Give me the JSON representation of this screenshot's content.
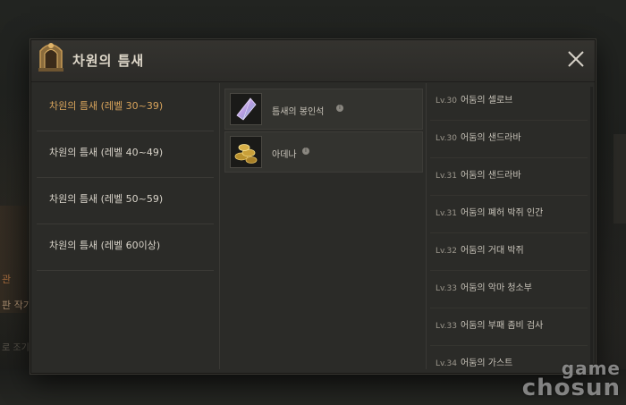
{
  "dialog": {
    "title": "차원의 틈새"
  },
  "levels": [
    {
      "label": "차원의 틈새 (레벨 30~39)"
    },
    {
      "label": "차원의 틈새 (레벨 40~49)"
    },
    {
      "label": "차원의 틈새 (레벨 50~59)"
    },
    {
      "label": "차원의 틈새 (레벨 60이상)"
    }
  ],
  "rewards": [
    {
      "label": "틈새의 봉인석",
      "icon": "crystal-icon"
    },
    {
      "label": "아데나",
      "icon": "gold-coins-icon"
    }
  ],
  "monsters": [
    {
      "level": "Lv.30",
      "name": "어둠의 셀로브"
    },
    {
      "level": "Lv.30",
      "name": "어둠의 샌드라바"
    },
    {
      "level": "Lv.31",
      "name": "어둠의 샌드라바"
    },
    {
      "level": "Lv.31",
      "name": "어둠의 폐허 박쥐 인간"
    },
    {
      "level": "Lv.32",
      "name": "어둠의 거대 박쥐"
    },
    {
      "level": "Lv.33",
      "name": "어둠의 악마 청소부"
    },
    {
      "level": "Lv.33",
      "name": "어둠의 부패 좀비 검사"
    },
    {
      "level": "Lv.34",
      "name": "어둠의 가스트"
    }
  ],
  "background": {
    "side_text_1": "관",
    "side_text_2": "판 작가",
    "side_text_3": "로 조기"
  },
  "watermark": {
    "line1": "game",
    "line2": "chosun"
  }
}
